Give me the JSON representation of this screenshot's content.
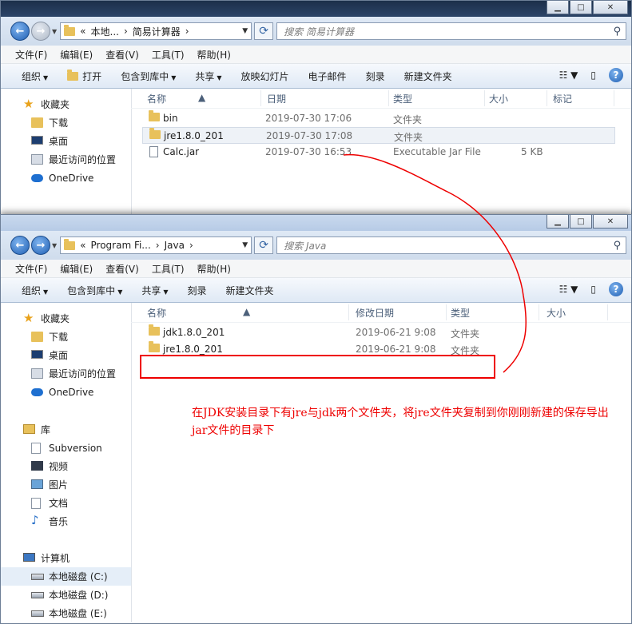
{
  "win1": {
    "address_path": [
      "«",
      "本地...",
      "简易计算器"
    ],
    "search_placeholder": "搜索 简易计算器",
    "menu": [
      "文件(F)",
      "编辑(E)",
      "查看(V)",
      "工具(T)",
      "帮助(H)"
    ],
    "toolbar": [
      "组织",
      "打开",
      "包含到库中",
      "共享",
      "放映幻灯片",
      "电子邮件",
      "刻录",
      "新建文件夹"
    ],
    "nav": [
      "收藏夹",
      "下载",
      "桌面",
      "最近访问的位置",
      "OneDrive"
    ],
    "columns": [
      "名称",
      "日期",
      "类型",
      "大小",
      "标记"
    ],
    "files": [
      {
        "name": "bin",
        "date": "2019-07-30 17:06",
        "type": "文件夹",
        "size": ""
      },
      {
        "name": "jre1.8.0_201",
        "date": "2019-07-30 17:08",
        "type": "文件夹",
        "size": ""
      },
      {
        "name": "Calc.jar",
        "date": "2019-07-30 16:53",
        "type": "Executable Jar File",
        "size": "5 KB"
      }
    ]
  },
  "win2": {
    "address_path": [
      "«",
      "Program Fi...",
      "Java"
    ],
    "search_placeholder": "搜索 Java",
    "menu": [
      "文件(F)",
      "编辑(E)",
      "查看(V)",
      "工具(T)",
      "帮助(H)"
    ],
    "toolbar": [
      "组织",
      "包含到库中",
      "共享",
      "刻录",
      "新建文件夹"
    ],
    "nav": [
      "收藏夹",
      "下载",
      "桌面",
      "最近访问的位置",
      "OneDrive",
      "库",
      "Subversion",
      "视频",
      "图片",
      "文档",
      "音乐",
      "计算机",
      "本地磁盘 (C:)",
      "本地磁盘 (D:)",
      "本地磁盘 (E:)"
    ],
    "columns": [
      "名称",
      "修改日期",
      "类型",
      "大小"
    ],
    "files": [
      {
        "name": "jdk1.8.0_201",
        "date": "2019-06-21 9:08",
        "type": "文件夹"
      },
      {
        "name": "jre1.8.0_201",
        "date": "2019-06-21 9:08",
        "type": "文件夹"
      }
    ]
  },
  "annotation": {
    "text": "在JDK安装目录下有jre与jdk两个文件夹，将jre文件夹复制到你刚刚新建的保存导出jar文件的目录下",
    "color": "#e00000"
  }
}
